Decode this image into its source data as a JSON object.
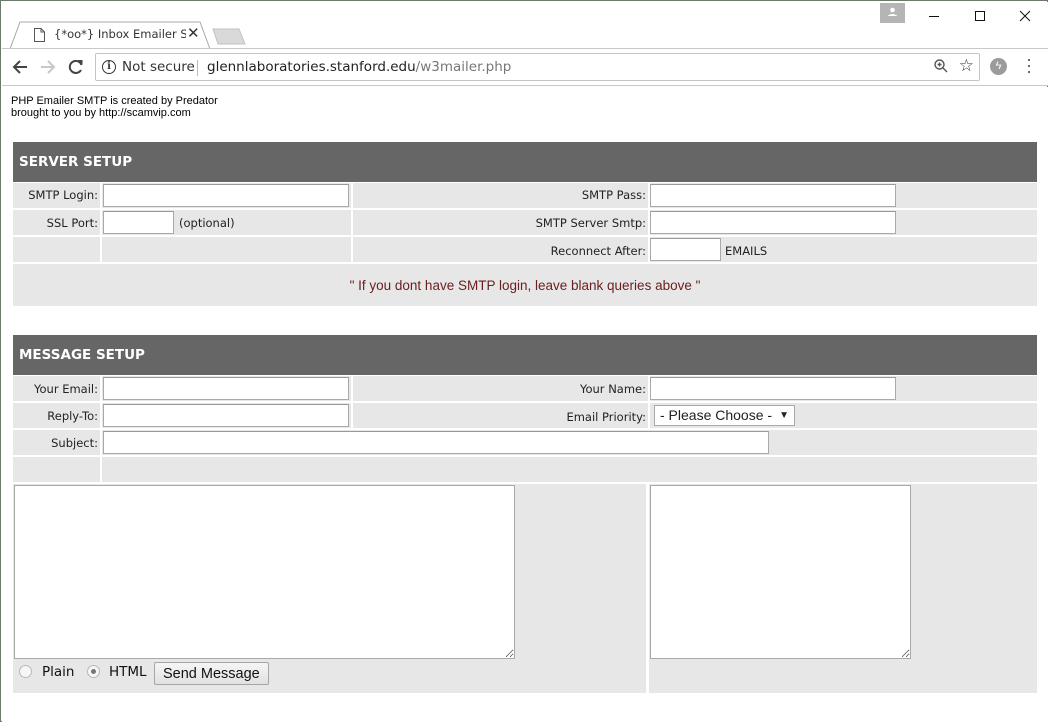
{
  "browser": {
    "tab_title": "{*oo*} Inbox Emailer SMTP",
    "security_label": "Not secure",
    "url_host": "glennlaboratories.stanford.edu",
    "url_path": "/w3mailer.php",
    "icons": {
      "tab_page": "page-icon",
      "tab_close": "close-icon",
      "back": "arrow-left-icon",
      "forward": "arrow-right-icon",
      "reload": "reload-icon",
      "info": "info-icon",
      "zoom": "zoom-in-icon",
      "bookmark": "star-icon",
      "extension": "lightning-icon",
      "menu": "kebab-menu-icon",
      "profile": "profile-icon"
    }
  },
  "credit": {
    "line1": "PHP Emailer SMTP is created by Predator",
    "line2": "brought to you by http://scamvip.com"
  },
  "server_setup": {
    "title": "SERVER SETUP",
    "smtp_login_label": "SMTP Login:",
    "smtp_login_value": "",
    "smtp_pass_label": "SMTP Pass:",
    "smtp_pass_value": "",
    "ssl_port_label": "SSL Port:",
    "ssl_port_value": "",
    "ssl_port_hint": "(optional)",
    "smtp_server_label": "SMTP Server Smtp:",
    "smtp_server_value": "",
    "reconnect_label": "Reconnect After:",
    "reconnect_value": "",
    "reconnect_unit": "EMAILS",
    "notice": "\" If you dont have SMTP login, leave blank queries above \""
  },
  "message_setup": {
    "title": "MESSAGE SETUP",
    "your_email_label": "Your Email:",
    "your_email_value": "",
    "your_name_label": "Your Name:",
    "your_name_value": "",
    "reply_to_label": "Reply-To:",
    "reply_to_value": "",
    "priority_label": "Email Priority:",
    "priority_selected": "- Please Choose -",
    "subject_label": "Subject:",
    "subject_value": "",
    "message_body": "",
    "email_list": "",
    "format_options": [
      {
        "label": "Plain",
        "checked": false
      },
      {
        "label": "HTML",
        "checked": true
      }
    ],
    "send_label": "Send Message"
  }
}
